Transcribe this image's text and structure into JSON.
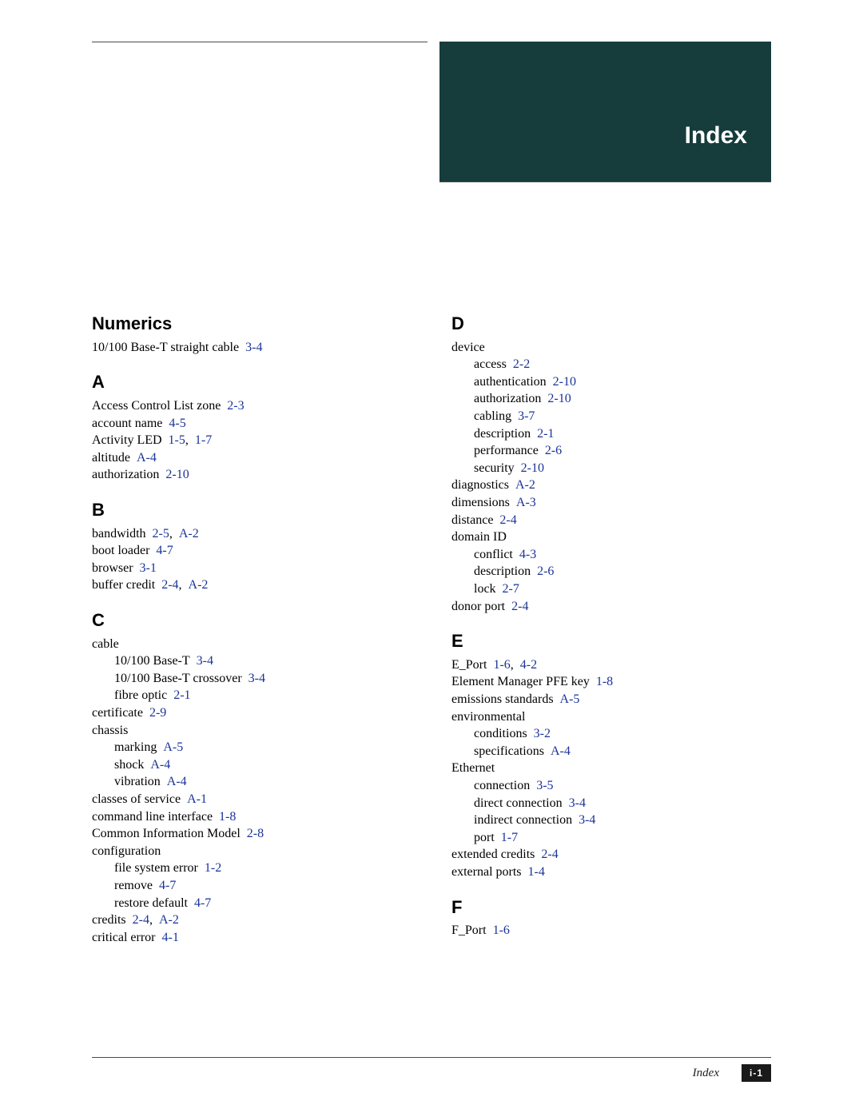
{
  "header": {
    "title": "Index"
  },
  "footer": {
    "title": "Index",
    "page": "i-1"
  },
  "col1": {
    "numerics": {
      "heading": "Numerics",
      "e0": {
        "t": "10/100 Base-T straight cable",
        "r": "3-4"
      }
    },
    "A": {
      "heading": "A",
      "e0": {
        "t": "Access Control List zone",
        "r": "2-3"
      },
      "e1": {
        "t": "account name",
        "r": "4-5"
      },
      "e2": {
        "t": "Activity LED",
        "r1": "1-5",
        "r2": "1-7"
      },
      "e3": {
        "t": "altitude",
        "r": "A-4"
      },
      "e4": {
        "t": "authorization",
        "r": "2-10"
      }
    },
    "B": {
      "heading": "B",
      "e0": {
        "t": "bandwidth",
        "r1": "2-5",
        "r2": "A-2"
      },
      "e1": {
        "t": "boot loader",
        "r": "4-7"
      },
      "e2": {
        "t": "browser",
        "r": "3-1"
      },
      "e3": {
        "t": "buffer credit",
        "r1": "2-4",
        "r2": "A-2"
      }
    },
    "C": {
      "heading": "C",
      "e0": {
        "t": "cable"
      },
      "e0a": {
        "t": "10/100 Base-T",
        "r": "3-4"
      },
      "e0b": {
        "t": "10/100 Base-T crossover",
        "r": "3-4"
      },
      "e0c": {
        "t": "fibre optic",
        "r": "2-1"
      },
      "e1": {
        "t": "certificate",
        "r": "2-9"
      },
      "e2": {
        "t": "chassis"
      },
      "e2a": {
        "t": "marking",
        "r": "A-5"
      },
      "e2b": {
        "t": "shock",
        "r": "A-4"
      },
      "e2c": {
        "t": "vibration",
        "r": "A-4"
      },
      "e3": {
        "t": "classes of service",
        "r": "A-1"
      },
      "e4": {
        "t": "command line interface",
        "r": "1-8"
      },
      "e5": {
        "t": "Common Information Model",
        "r": "2-8"
      },
      "e6": {
        "t": "configuration"
      },
      "e6a": {
        "t": "file system error",
        "r": "1-2"
      },
      "e6b": {
        "t": "remove",
        "r": "4-7"
      },
      "e6c": {
        "t": "restore default",
        "r": "4-7"
      },
      "e7": {
        "t": "credits",
        "r1": "2-4",
        "r2": "A-2"
      },
      "e8": {
        "t": "critical error",
        "r": "4-1"
      }
    }
  },
  "col2": {
    "D": {
      "heading": "D",
      "e0": {
        "t": "device"
      },
      "e0a": {
        "t": "access",
        "r": "2-2"
      },
      "e0b": {
        "t": "authentication",
        "r": "2-10"
      },
      "e0c": {
        "t": "authorization",
        "r": "2-10"
      },
      "e0d": {
        "t": "cabling",
        "r": "3-7"
      },
      "e0e": {
        "t": "description",
        "r": "2-1"
      },
      "e0f": {
        "t": "performance",
        "r": "2-6"
      },
      "e0g": {
        "t": "security",
        "r": "2-10"
      },
      "e1": {
        "t": "diagnostics",
        "r": "A-2"
      },
      "e2": {
        "t": "dimensions",
        "r": "A-3"
      },
      "e3": {
        "t": "distance",
        "r": "2-4"
      },
      "e4": {
        "t": "domain ID"
      },
      "e4a": {
        "t": "conflict",
        "r": "4-3"
      },
      "e4b": {
        "t": "description",
        "r": "2-6"
      },
      "e4c": {
        "t": "lock",
        "r": "2-7"
      },
      "e5": {
        "t": "donor port",
        "r": "2-4"
      }
    },
    "E": {
      "heading": "E",
      "e0": {
        "t": "E_Port",
        "r1": "1-6",
        "r2": "4-2"
      },
      "e1": {
        "t": "Element Manager PFE key",
        "r": "1-8"
      },
      "e2": {
        "t": "emissions standards",
        "r": "A-5"
      },
      "e3": {
        "t": "environmental"
      },
      "e3a": {
        "t": "conditions",
        "r": "3-2"
      },
      "e3b": {
        "t": "specifications",
        "r": "A-4"
      },
      "e4": {
        "t": "Ethernet"
      },
      "e4a": {
        "t": "connection",
        "r": "3-5"
      },
      "e4b": {
        "t": "direct connection",
        "r": "3-4"
      },
      "e4c": {
        "t": "indirect connection",
        "r": "3-4"
      },
      "e4d": {
        "t": "port",
        "r": "1-7"
      },
      "e5": {
        "t": "extended credits",
        "r": "2-4"
      },
      "e6": {
        "t": "external ports",
        "r": "1-4"
      }
    },
    "F": {
      "heading": "F",
      "e0": {
        "t": "F_Port",
        "r": "1-6"
      }
    }
  }
}
